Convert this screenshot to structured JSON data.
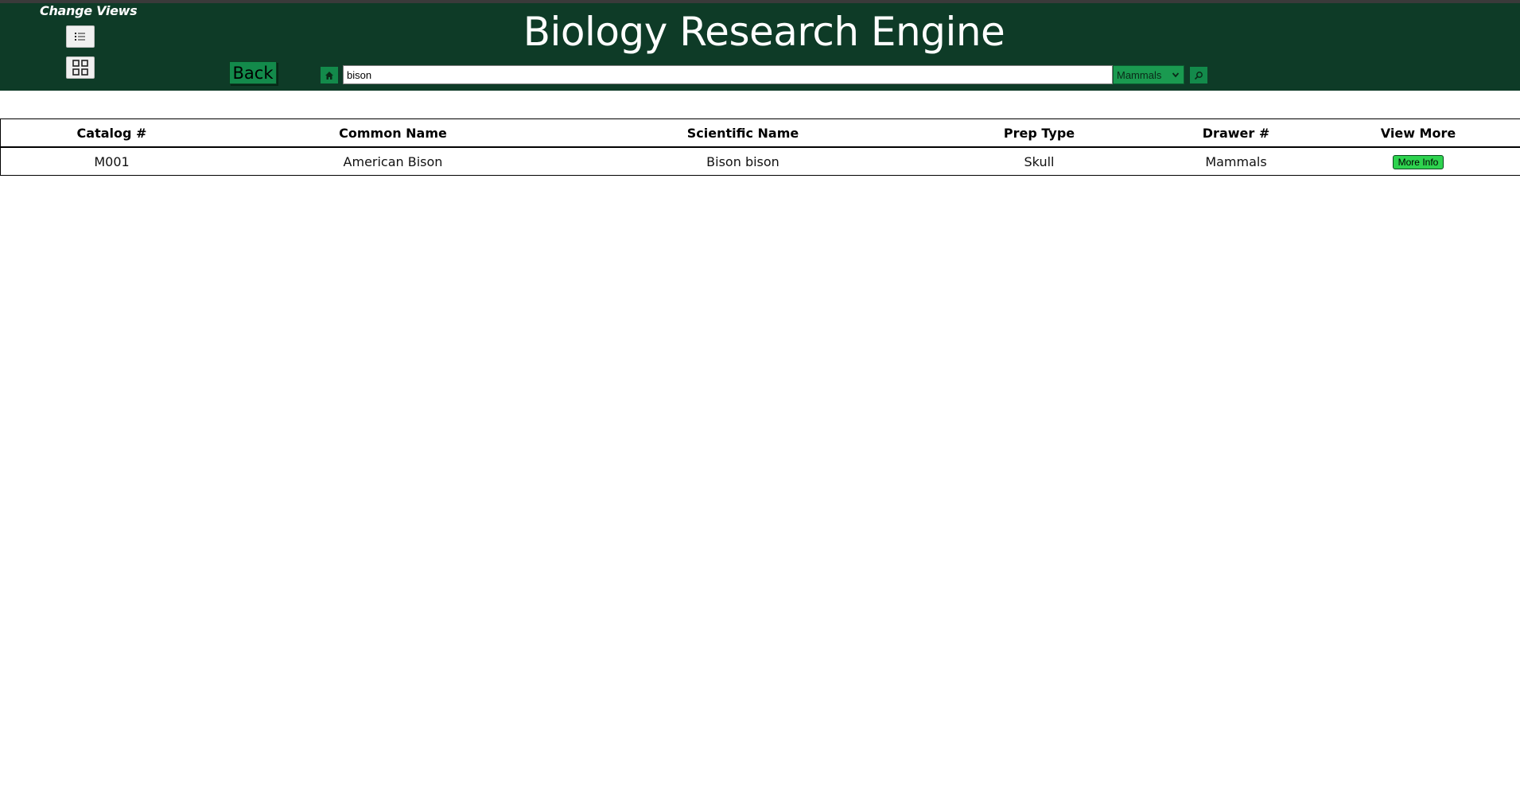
{
  "app": {
    "title": "Biology Research Engine"
  },
  "view_switch": {
    "label": "Change Views",
    "list_icon": "list-icon",
    "grid_icon": "grid-icon"
  },
  "nav": {
    "back_label": "Back",
    "home_icon": "home-icon"
  },
  "search": {
    "value": "bison",
    "category": "Mammals",
    "search_icon": "search-icon"
  },
  "table": {
    "headers": [
      "Catalog #",
      "Common Name",
      "Scientific Name",
      "Prep Type",
      "Drawer #",
      "View More"
    ],
    "rows": [
      {
        "catalog": "M001",
        "common_name": "American Bison",
        "scientific_name": "Bison bison",
        "prep_type": "Skull",
        "drawer": "Mammals",
        "action_label": "More Info"
      }
    ]
  },
  "colors": {
    "header_bg": "#0e3b27",
    "button_green": "#138a4b",
    "more_info_green": "#2ed34f"
  }
}
